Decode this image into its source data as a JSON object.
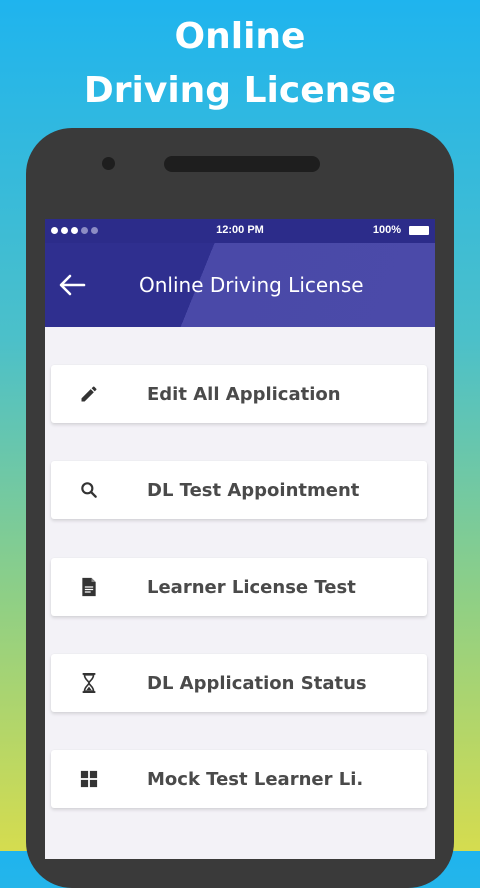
{
  "promo": {
    "line1": "Online",
    "line2": "Driving License"
  },
  "status_bar": {
    "time": "12:00 PM",
    "battery": "100%"
  },
  "app_bar": {
    "title": "Online Driving License",
    "back_icon": "arrow-back-icon"
  },
  "menu": [
    {
      "label": "Edit All Application",
      "icon": "pencil-icon"
    },
    {
      "label": "DL  Test Appointment",
      "icon": "search-icon"
    },
    {
      "label": "Learner License Test",
      "icon": "document-icon"
    },
    {
      "label": "DL Application Status",
      "icon": "hourglass-icon"
    },
    {
      "label": "Mock Test Learner Li.",
      "icon": "grid-icon"
    }
  ],
  "colors": {
    "status_bar": "#2c2c8a",
    "app_bar_dark": "#2f2f8f",
    "app_bar_light": "#4b4aa9",
    "screen_bg": "#f3f2f7",
    "card_text": "#4a4a4a"
  }
}
